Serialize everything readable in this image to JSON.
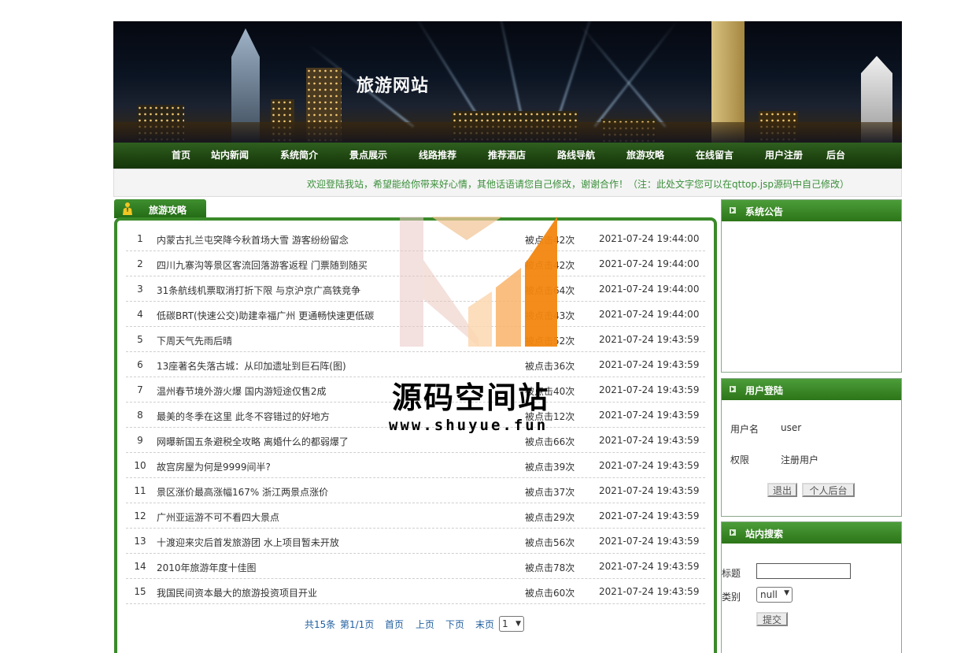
{
  "banner": {
    "title": "旅游网站"
  },
  "nav": [
    {
      "label": "首页"
    },
    {
      "label": "站内新闻"
    },
    {
      "label": "系统简介"
    },
    {
      "label": "景点展示"
    },
    {
      "label": "线路推荐"
    },
    {
      "label": "推荐酒店"
    },
    {
      "label": "路线导航"
    },
    {
      "label": "旅游攻略"
    },
    {
      "label": "在线留言"
    },
    {
      "label": "用户注册"
    },
    {
      "label": "后台"
    }
  ],
  "marquee": {
    "text": "欢迎登陆我站，希望能给你带来好心情，其他话语请您自己修改，谢谢合作！（注：此处文字您可以在qttop.jsp源码中自己修改）"
  },
  "guides": {
    "tab_label": "旅游攻略",
    "rows": [
      {
        "no": "1",
        "title": "内蒙古扎兰屯突降今秋首场大雪 游客纷纷留念",
        "hits": "被点击42次",
        "date": "2021-07-24 19:44:00"
      },
      {
        "no": "2",
        "title": "四川九寨沟等景区客流回落游客返程 门票随到随买",
        "hits": "被点击42次",
        "date": "2021-07-24 19:44:00"
      },
      {
        "no": "3",
        "title": "31条航线机票取消打折下限 与京沪京广高铁竞争",
        "hits": "被点击64次",
        "date": "2021-07-24 19:44:00"
      },
      {
        "no": "4",
        "title": "低碳BRT(快速公交)助建幸福广州 更通畅快速更低碳",
        "hits": "被点击43次",
        "date": "2021-07-24 19:44:00"
      },
      {
        "no": "5",
        "title": "下周天气先雨后晴",
        "hits": "被点击52次",
        "date": "2021-07-24 19:43:59"
      },
      {
        "no": "6",
        "title": "13座著名失落古城：从印加遗址到巨石阵(图)",
        "hits": "被点击36次",
        "date": "2021-07-24 19:43:59"
      },
      {
        "no": "7",
        "title": "温州春节境外游火爆 国内游短途仅售2成",
        "hits": "被点击40次",
        "date": "2021-07-24 19:43:59"
      },
      {
        "no": "8",
        "title": "最美的冬季在这里 此冬不容错过的好地方",
        "hits": "被点击12次",
        "date": "2021-07-24 19:43:59"
      },
      {
        "no": "9",
        "title": "网曝新国五条避税全攻略 离婚什么的都弱爆了",
        "hits": "被点击66次",
        "date": "2021-07-24 19:43:59"
      },
      {
        "no": "10",
        "title": "故宫房屋为何是9999间半?",
        "hits": "被点击39次",
        "date": "2021-07-24 19:43:59"
      },
      {
        "no": "11",
        "title": "景区涨价最高涨幅167% 浙江两景点涨价",
        "hits": "被点击37次",
        "date": "2021-07-24 19:43:59"
      },
      {
        "no": "12",
        "title": "广州亚运游不可不看四大景点",
        "hits": "被点击29次",
        "date": "2021-07-24 19:43:59"
      },
      {
        "no": "13",
        "title": "十渡迎来灾后首发旅游团 水上项目暂未开放",
        "hits": "被点击56次",
        "date": "2021-07-24 19:43:59"
      },
      {
        "no": "14",
        "title": "2010年旅游年度十佳图",
        "hits": "被点击78次",
        "date": "2021-07-24 19:43:59"
      },
      {
        "no": "15",
        "title": "我国民间资本最大的旅游投资项目开业",
        "hits": "被点击60次",
        "date": "2021-07-24 19:43:59"
      }
    ],
    "pager": {
      "total": "共15条",
      "page_info": "第1/1页",
      "first": "首页",
      "prev": "上页",
      "next": "下页",
      "last": "末页",
      "select_value": "1"
    }
  },
  "announcement": {
    "title": "系统公告"
  },
  "login": {
    "title": "用户登陆",
    "username_label": "用户名",
    "username_value": "user",
    "role_label": "权限",
    "role_value": "注册用户",
    "logout_label": "退出",
    "admin_label": "个人后台"
  },
  "search": {
    "title": "站内搜索",
    "title_label": "标题",
    "title_value": "",
    "category_label": "类别",
    "category_value": "null",
    "submit_label": "提交"
  },
  "watermark": {
    "text": "源码空间站",
    "url": "www.shuyue.fun"
  },
  "colors": {
    "nav_green": "#1e4410",
    "accent_green": "#3a8a2a",
    "marquee_text": "#3a8f3a",
    "link_blue": "#1f5fa0"
  }
}
